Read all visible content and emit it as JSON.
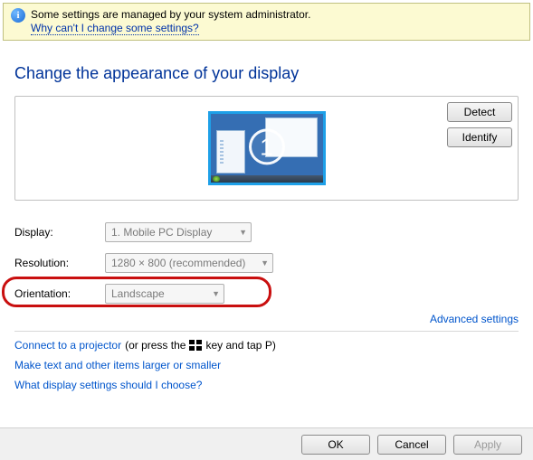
{
  "banner": {
    "message": "Some settings are managed by your system administrator.",
    "help_link": "Why can't I change some settings?"
  },
  "title": "Change the appearance of your display",
  "monitor_number": "1",
  "buttons": {
    "detect": "Detect",
    "identify": "Identify"
  },
  "fields": {
    "display": {
      "label": "Display:",
      "value": "1. Mobile PC Display"
    },
    "resolution": {
      "label": "Resolution:",
      "value": "1280 × 800 (recommended)"
    },
    "orientation": {
      "label": "Orientation:",
      "value": "Landscape"
    }
  },
  "advanced_link": "Advanced settings",
  "links": {
    "projector_a": "Connect to a projector",
    "projector_b": "(or press the",
    "projector_c": "key and tap P)",
    "dpi": "Make text and other items larger or smaller",
    "help": "What display settings should I choose?"
  },
  "footer": {
    "ok": "OK",
    "cancel": "Cancel",
    "apply": "Apply"
  }
}
